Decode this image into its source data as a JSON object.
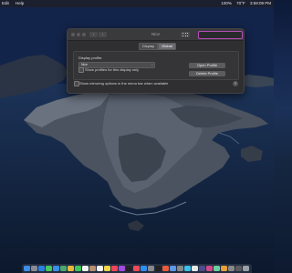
{
  "menubar": {
    "app_menu": "Edit",
    "help_menu": "Help",
    "status_left": "100%",
    "status_temp": "70°F",
    "clock": "3:59:09 PM"
  },
  "window": {
    "title": "Nice",
    "tabs": [
      "Display",
      "Global"
    ],
    "active_tab": "Global",
    "display_profile_label": "Display profile:",
    "display_profile_value": "Nice",
    "checkbox_label": "Show profiles for this display only",
    "open_button": "Open Profile",
    "delete_button": "Delete Profile",
    "menu_bar_label": "Show mirroring options in the menu bar when available",
    "help_label": "?"
  },
  "colors": {
    "accent": "#b44db8",
    "window_bg": "#2f2f31",
    "wallpaper": "#16284f"
  },
  "dock": {
    "icons": [
      "finder-icon",
      "launchpad-icon",
      "safari-icon",
      "messages-icon",
      "mail-icon",
      "maps-icon",
      "photos-icon",
      "facetime-icon",
      "calendar-icon",
      "contacts-icon",
      "reminders-icon",
      "notes-icon",
      "music-icon",
      "podcasts-icon",
      "tv-icon",
      "news-icon",
      "appstore-icon",
      "preferences-icon",
      "terminal-icon",
      "app-icon",
      "app-icon",
      "app-icon",
      "app-icon",
      "app-icon",
      "app-icon",
      "app-icon",
      "app-icon",
      "app-icon",
      "app-icon",
      "app-icon",
      "trash-icon"
    ],
    "colors": [
      "#3b8fe8",
      "#8a8a92",
      "#2a7fe0",
      "#47c760",
      "#3a8ee8",
      "#4aa870",
      "#e8b83a",
      "#3cc65a",
      "#f2f2f2",
      "#b89070",
      "#f2f2f2",
      "#f2d54a",
      "#f0455a",
      "#a34ae0",
      "#222",
      "#f04a5a",
      "#2f8ef0",
      "#8a8a8e",
      "#222",
      "#e85c3a",
      "#5a9ae8",
      "#888",
      "#3ac0e8",
      "#e8e8e8",
      "#4d4d8e",
      "#d04a8a",
      "#6ad0a0",
      "#e8a03a",
      "#888",
      "#5a5a5e",
      "#9aa0a8"
    ]
  }
}
